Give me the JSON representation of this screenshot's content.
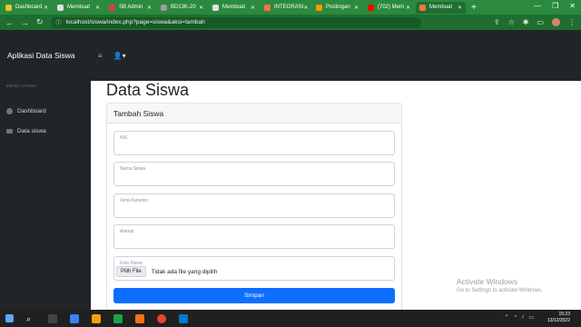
{
  "browser": {
    "tabs": [
      {
        "label": "Dashboard",
        "color": "#f1c232",
        "active": false
      },
      {
        "label": "Membuat",
        "color": "#e0e0e0",
        "active": false
      },
      {
        "label": "SB Admin",
        "color": "#e03e3e",
        "active": false
      },
      {
        "label": "BD13K-20",
        "color": "#9e9e9e",
        "active": false
      },
      {
        "label": "Membuat",
        "color": "#e0e0e0",
        "active": false
      },
      {
        "label": "INTEGRASI",
        "color": "#ff7043",
        "active": false
      },
      {
        "label": "Postingan",
        "color": "#ff9800",
        "active": false
      },
      {
        "label": "(702) Mem",
        "color": "#ff0000",
        "active": false
      },
      {
        "label": "Membuat",
        "color": "#ff7043",
        "active": true
      }
    ],
    "new_tab": "+",
    "url": "localhost/siswa/index.php?page=siswa&aksi=tambah"
  },
  "app": {
    "brand": "Aplikasi Data Siswa",
    "menu_heading": "MENU UTAMA",
    "menu": [
      {
        "label": "Dashboard"
      },
      {
        "label": "Data siswa"
      }
    ]
  },
  "page": {
    "title": "Data Siswa",
    "card_title": "Tambah Siswa",
    "fields": [
      {
        "placeholder": "NIS"
      },
      {
        "placeholder": "Nama Siswa"
      },
      {
        "placeholder": "Jenis Kelamin"
      },
      {
        "placeholder": "Alamat"
      }
    ],
    "photo": {
      "label": "Foto Siswa",
      "button": "Pilih File",
      "status": "Tidak ada file yang dipilih"
    },
    "submit": "Simpan"
  },
  "watermark": {
    "line1": "Activate Windows",
    "line2": "Go to Settings to activate Windows."
  },
  "taskbar": {
    "time": "15:23",
    "date": "13/12/2022"
  }
}
